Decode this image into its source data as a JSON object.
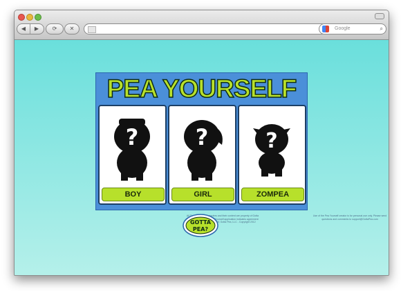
{
  "browser": {
    "nav_back_glyph": "◀",
    "nav_forward_glyph": "▶",
    "reload_glyph": "⟳",
    "stop_glyph": "✕",
    "home_glyph": "⌂",
    "url": "",
    "go_glyph": "▶",
    "search_placeholder": "Google",
    "search_glyph": "⌕"
  },
  "page": {
    "title": "PEA YOURSELF",
    "cards": [
      {
        "label": "BOY"
      },
      {
        "label": "GIRL"
      },
      {
        "label": "ZOMPEA"
      }
    ],
    "footer_left": "All The GottaPea characters and their content are property of Gotta Pea, LLC. Use of the Pea Yourself application indicates agreement with all terms and copyright. Gotta Pea, LLC - Copyright 2012",
    "footer_right": "Use of the Pea Yourself creator is for personal use only. Please send questions and comments to support@GottaPea.com",
    "logo_text": "GOTTA PEA?"
  },
  "colors": {
    "accent_green": "#b7e02b",
    "panel_blue": "#4b8fd9",
    "background_cyan": "#6adfdc"
  }
}
